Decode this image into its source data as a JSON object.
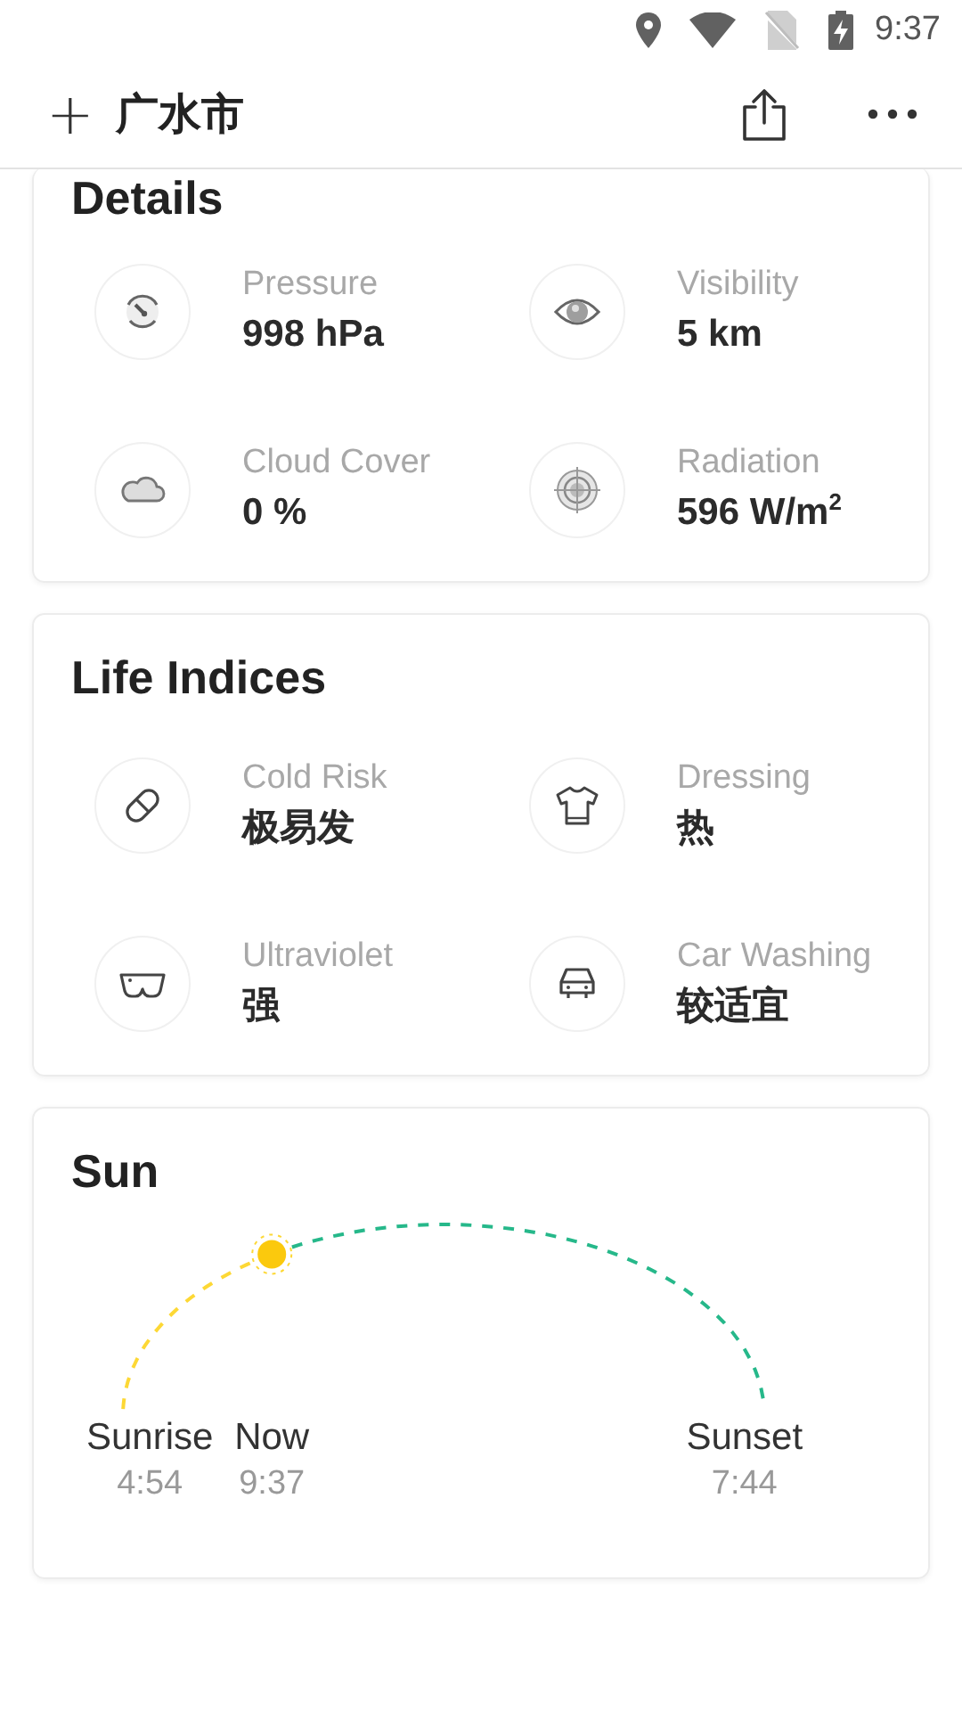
{
  "status_bar": {
    "time": "9:37"
  },
  "header": {
    "add_icon": "+",
    "city": "广水市"
  },
  "details": {
    "title": "Details",
    "items": [
      {
        "kind": "pressure",
        "label": "Pressure",
        "value": "998 hPa"
      },
      {
        "kind": "visibility",
        "label": "Visibility",
        "value": "5 km"
      },
      {
        "kind": "cloud",
        "label": "Cloud Cover",
        "value": "0 %"
      },
      {
        "kind": "radiation",
        "label": "Radiation",
        "value": "596 W/m$^{2}$"
      }
    ]
  },
  "life_indices": {
    "title": "Life Indices",
    "items": [
      {
        "kind": "pill",
        "label": "Cold Risk",
        "value": "极易发"
      },
      {
        "kind": "shirt",
        "label": "Dressing",
        "value": "热"
      },
      {
        "kind": "glasses",
        "label": "Ultraviolet",
        "value": "强"
      },
      {
        "kind": "car",
        "label": "Car Washing",
        "value": "较适宜"
      }
    ]
  },
  "sun": {
    "title": "Sun",
    "level": 0.32,
    "sunrise": {
      "label": "Sunrise",
      "time": "4:54"
    },
    "now": {
      "label": "Now",
      "time": "9:37"
    },
    "sunset": {
      "label": "Sunset",
      "time": "7:44"
    }
  }
}
